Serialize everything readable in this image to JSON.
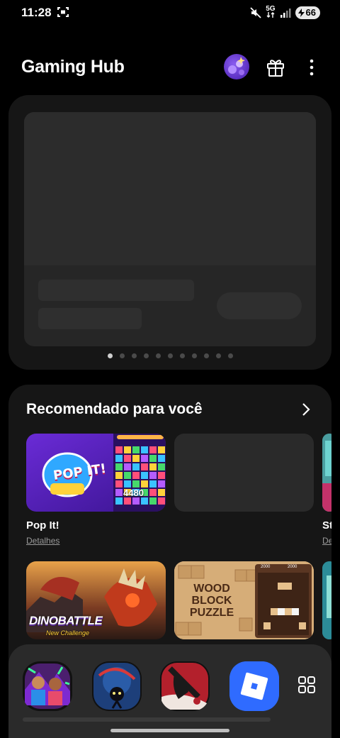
{
  "status_bar": {
    "time": "11:28",
    "network": "5G",
    "battery": "66"
  },
  "header": {
    "title": "Gaming Hub"
  },
  "banner": {
    "total_pages": 11,
    "active_page": 1
  },
  "recommended": {
    "title": "Recomendado para você",
    "games": [
      {
        "name": "Pop It!",
        "link": "Detalhes",
        "thumb_text": "POP IT!",
        "score": "4480"
      },
      {
        "name": "",
        "link": ""
      },
      {
        "name": "St",
        "link": "Det"
      }
    ],
    "row2": [
      {
        "thumb_text": "DINOBATTLE",
        "sub": "New Challenge"
      },
      {
        "thumb_text": "WOOD BLOCK PUZZLE",
        "score_a": "2000",
        "score_b": "2000"
      }
    ]
  },
  "dock": {
    "apps": [
      "football-game",
      "ninja-game",
      "samurai-game",
      "roblox"
    ]
  },
  "colors": {
    "background": "#000000",
    "card": "#161616",
    "dock": "#2a2a2a",
    "roblox_blue": "#2f6bff"
  }
}
